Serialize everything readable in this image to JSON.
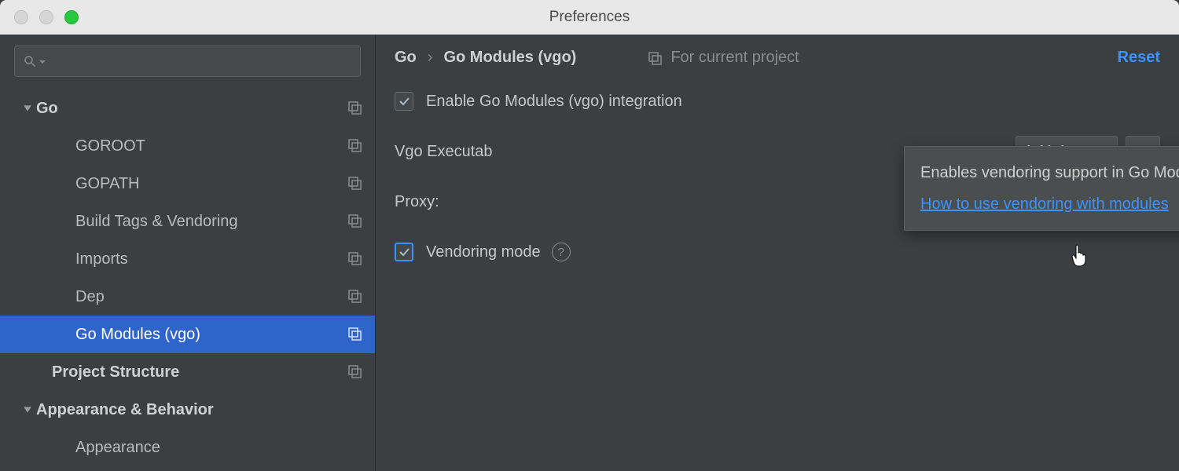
{
  "window": {
    "title": "Preferences"
  },
  "search": {
    "placeholder": ""
  },
  "sidebar": {
    "go": {
      "label": "Go",
      "children": {
        "goroot": "GOROOT",
        "gopath": "GOPATH",
        "buildtags": "Build Tags & Vendoring",
        "imports": "Imports",
        "dep": "Dep",
        "gomodules": "Go Modules (vgo)"
      },
      "project_structure": "Project Structure"
    },
    "appearance": {
      "label": "Appearance & Behavior",
      "children": {
        "appearance": "Appearance"
      }
    }
  },
  "crumbs": {
    "root": "Go",
    "leaf": "Go Modules (vgo)",
    "scope": "For current project",
    "reset": "Reset"
  },
  "form": {
    "enable_label": "Enable Go Modules (vgo) integration",
    "exec_label": "Vgo Executab",
    "version": "1.11.1",
    "ellipsis": "...",
    "proxy_label": "Proxy:",
    "vendoring_label": "Vendoring mode"
  },
  "tooltip": {
    "text": "Enables vendoring support in Go Modules project.",
    "link": "How to use vendoring with modules"
  }
}
